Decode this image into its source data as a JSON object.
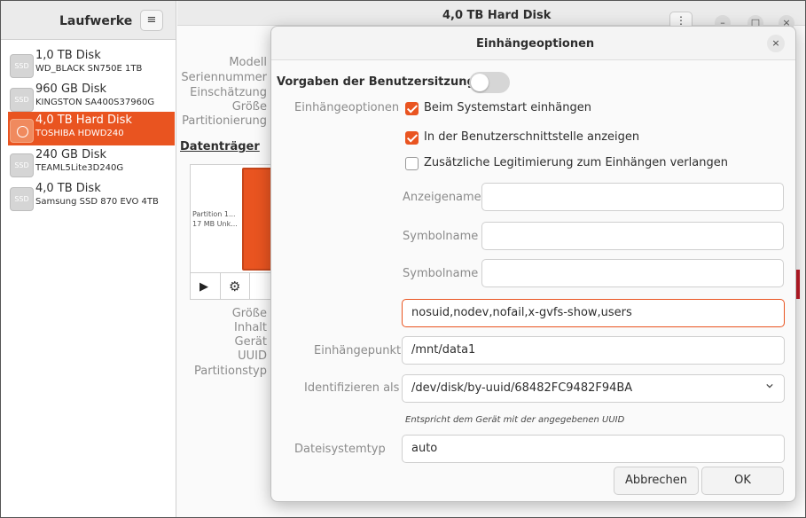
{
  "sidebar": {
    "title": "Laufwerke",
    "menu_icon": "hamburger-icon",
    "menu_glyph": "≡",
    "disks": [
      {
        "name": "1,0 TB Disk",
        "model": "WD_BLACK SN750E 1TB",
        "icon": "ssd-icon",
        "icon_text": "SSD"
      },
      {
        "name": "960 GB Disk",
        "model": "KINGSTON SA400S37960G",
        "icon": "ssd-icon",
        "icon_text": "SSD"
      },
      {
        "name": "4,0 TB Hard Disk",
        "model": "TOSHIBA HDWD240",
        "icon": "hard-disk-icon",
        "icon_text": ""
      },
      {
        "name": "240 GB Disk",
        "model": "TEAML5Lite3D240G",
        "icon": "ssd-icon",
        "icon_text": "SSD"
      },
      {
        "name": "4,0 TB Disk",
        "model": "Samsung SSD 870 EVO 4TB",
        "icon": "ssd-icon",
        "icon_text": "SSD"
      }
    ],
    "selected_index": 2
  },
  "main": {
    "title": "4,0 TB Hard Disk",
    "menu_glyph": "⋮",
    "window_controls": {
      "minimize": "–",
      "maximize": "□",
      "close": "×"
    },
    "info_labels": [
      "Modell",
      "Seriennummer",
      "Einschätzung",
      "Größe",
      "Partitionierung"
    ],
    "volumes_heading": "Datenträger",
    "partition_text": "Partition 1...\n17 MB Unk...",
    "partition_line1": "Partition 1...",
    "partition_line2": "17 MB Unk...",
    "toolbar": {
      "play_icon": "play-icon",
      "play_glyph": "▶",
      "gear_icon": "gear-icon",
      "gear_glyph": "⚙"
    },
    "partition_labels": [
      "Größe",
      "Inhalt",
      "Gerät",
      "UUID",
      "Partitionstyp"
    ]
  },
  "dialog": {
    "title": "Einhängeoptionen",
    "close_glyph": "×",
    "defaults_label": "Vorgaben der Benutzersitzung",
    "defaults_on": false,
    "mount_options_label": "Einhängeoptionen",
    "checkboxes": [
      {
        "label": "Beim Systemstart einhängen",
        "checked": true
      },
      {
        "label": "In der Benutzerschnittstelle anzeigen",
        "checked": true
      },
      {
        "label": "Zusätzliche Legitimierung zum Einhängen verlangen",
        "checked": false
      }
    ],
    "display_name_label": "Anzeigename",
    "display_name_value": "",
    "icon_name_label": "Symbolname",
    "icon_name_value": "",
    "symbolic_icon_label": "Symbolname",
    "symbolic_icon_value": "",
    "options_value": "nosuid,nodev,nofail,x-gvfs-show,users",
    "mount_point_label": "Einhängepunkt",
    "mount_point_value": "/mnt/data1",
    "identify_as_label": "Identifizieren als",
    "identify_as_value": "/dev/disk/by-uuid/68482FC9482F94BA",
    "identify_hint": "Entspricht dem Gerät mit der angegebenen UUID",
    "fs_type_label": "Dateisystemtyp",
    "fs_type_value": "auto",
    "cancel_label": "Abbrechen",
    "ok_label": "OK"
  },
  "colors": {
    "accent": "#e95420",
    "sidebar_bg": "#ffffff",
    "header_bg": "#ebebeb",
    "danger": "#c01c28"
  }
}
